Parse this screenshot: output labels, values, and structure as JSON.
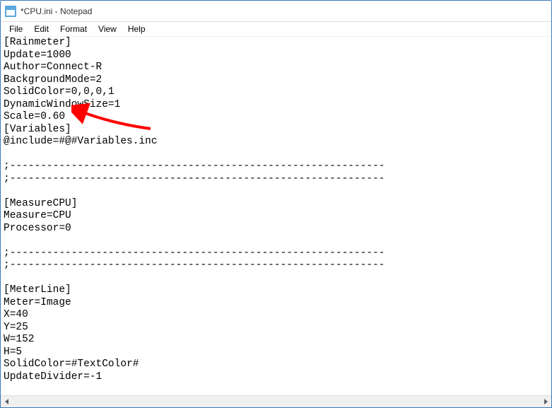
{
  "window": {
    "title": "*CPU.ini - Notepad"
  },
  "menu": {
    "items": [
      "File",
      "Edit",
      "Format",
      "View",
      "Help"
    ]
  },
  "editor": {
    "lines": [
      "[Rainmeter]",
      "Update=1000",
      "Author=Connect-R",
      "BackgroundMode=2",
      "SolidColor=0,0,0,1",
      "DynamicWindowSize=1",
      "Scale=0.60",
      "[Variables]",
      "@include=#@#Variables.inc",
      "",
      ";-------------------------------------------------------------",
      ";-------------------------------------------------------------",
      "",
      "[MeasureCPU]",
      "Measure=CPU",
      "Processor=0",
      "",
      ";-------------------------------------------------------------",
      ";-------------------------------------------------------------",
      "",
      "[MeterLine]",
      "Meter=Image",
      "X=40",
      "Y=25",
      "W=152",
      "H=5",
      "SolidColor=#TextColor#",
      "UpdateDivider=-1"
    ]
  },
  "annotation": {
    "arrow_target": "Scale=0.60",
    "arrow_color": "#ff0000"
  }
}
